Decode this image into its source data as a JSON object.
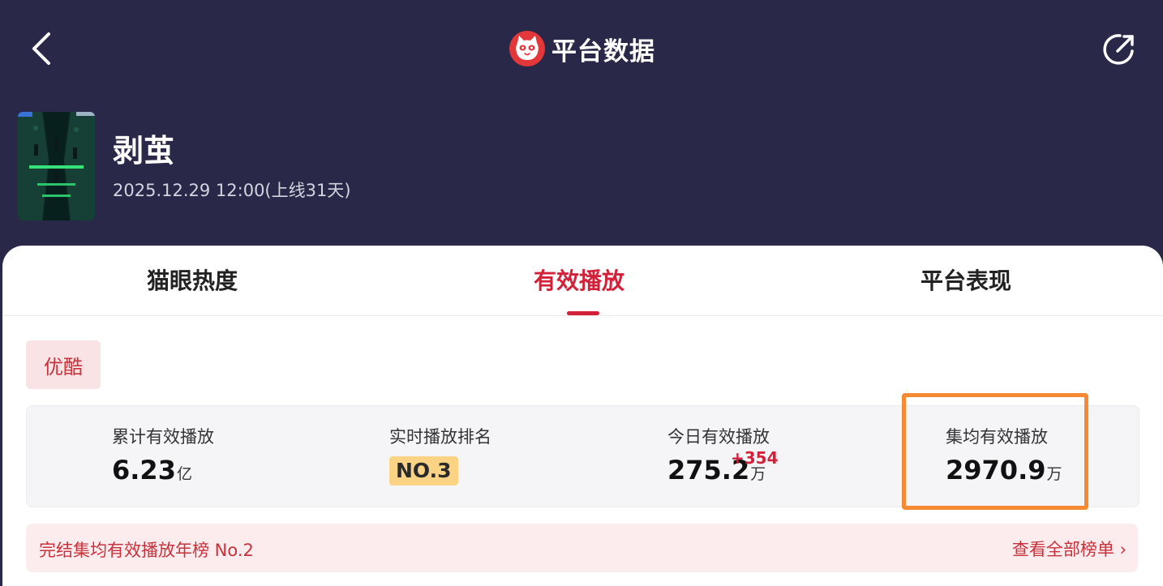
{
  "header": {
    "title": "平台数据",
    "back_icon": "chevron-left-icon",
    "share_icon": "share-icon",
    "logo_icon": "maoyan-cat-logo"
  },
  "movie": {
    "name": "剥茧",
    "release": "2025.12.29 12:00(上线31天)"
  },
  "tabs": [
    {
      "label": "猫眼热度",
      "active": false
    },
    {
      "label": "有效播放",
      "active": true
    },
    {
      "label": "平台表现",
      "active": false
    }
  ],
  "platform": {
    "label": "优酷"
  },
  "stats": {
    "total": {
      "label": "累计有效播放",
      "value": "6.23",
      "unit": "亿"
    },
    "rank": {
      "label": "实时播放排名",
      "value": "NO.3"
    },
    "today": {
      "label": "今日有效播放",
      "value": "275.2",
      "unit": "万",
      "delta": "+354"
    },
    "avg": {
      "label": "集均有效播放",
      "value": "2970.9",
      "unit": "万"
    }
  },
  "ranking": {
    "text": "完结集均有效播放年榜 No.2",
    "link": "查看全部榜单 ›"
  },
  "colors": {
    "background": "#2a2849",
    "accent": "#d3213a",
    "highlight": "#f58a32",
    "rank_badge": "#fbd385"
  }
}
